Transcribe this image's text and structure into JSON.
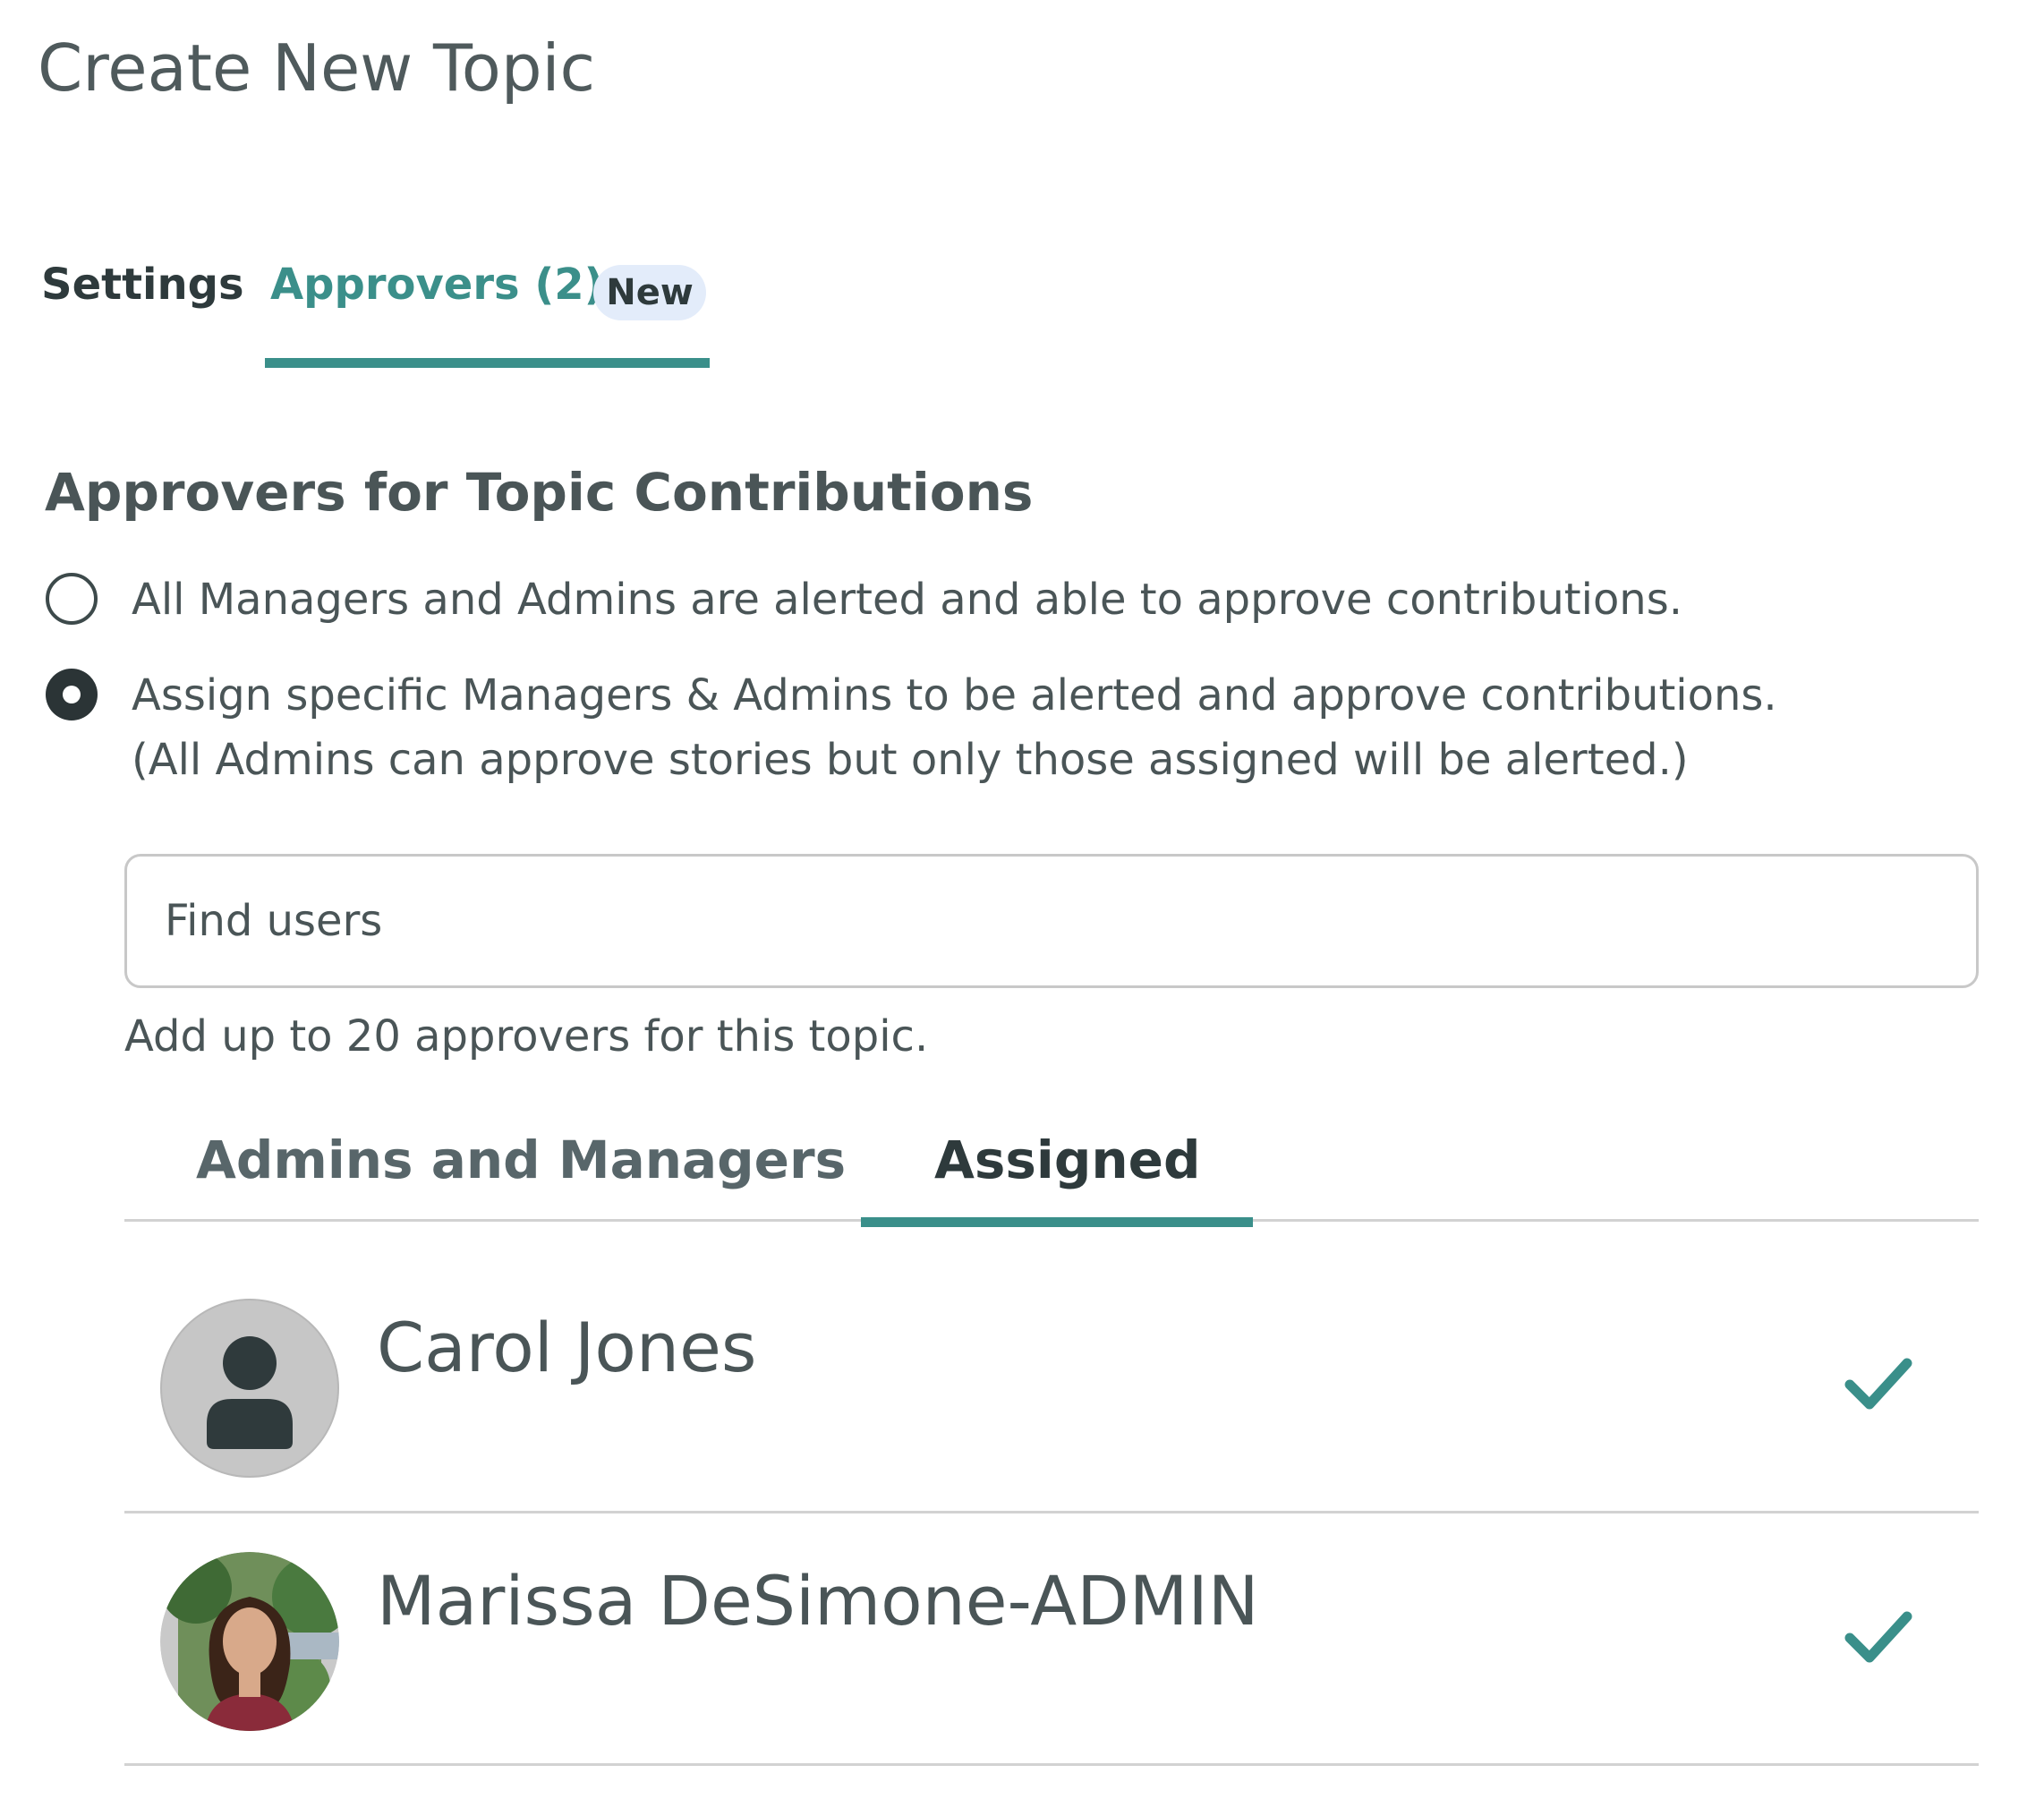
{
  "page": {
    "title": "Create New Topic"
  },
  "tabs": {
    "settings_label": "Settings",
    "approvers_label": "Approvers (2)",
    "approvers_badge": "New",
    "active": "approvers"
  },
  "approvers_section": {
    "heading": "Approvers for Topic Contributions",
    "options": [
      {
        "label": "All Managers and Admins are alerted and able to approve contributions.",
        "selected": false
      },
      {
        "label": "Assign specific Managers & Admins to be alerted and approve contributions.",
        "sublabel": "(All Admins can approve stories but only those assigned will be alerted.)",
        "selected": true
      }
    ],
    "search": {
      "placeholder": "Find users",
      "value": ""
    },
    "helper_text": "Add up to 20 approvers for this topic.",
    "sub_tabs": {
      "admins_label": "Admins and Managers",
      "assigned_label": "Assigned",
      "active": "assigned"
    },
    "assigned_users": [
      {
        "name": "Carol Jones",
        "avatar": "generic-person-icon",
        "selected": true
      },
      {
        "name": "Marissa DeSimone-ADMIN",
        "avatar": "photo",
        "selected": true
      }
    ]
  },
  "colors": {
    "accent": "#3a8f8a",
    "text": "#4a5557",
    "badge_bg": "#e3ecfa",
    "divider": "#d2d2d2"
  }
}
